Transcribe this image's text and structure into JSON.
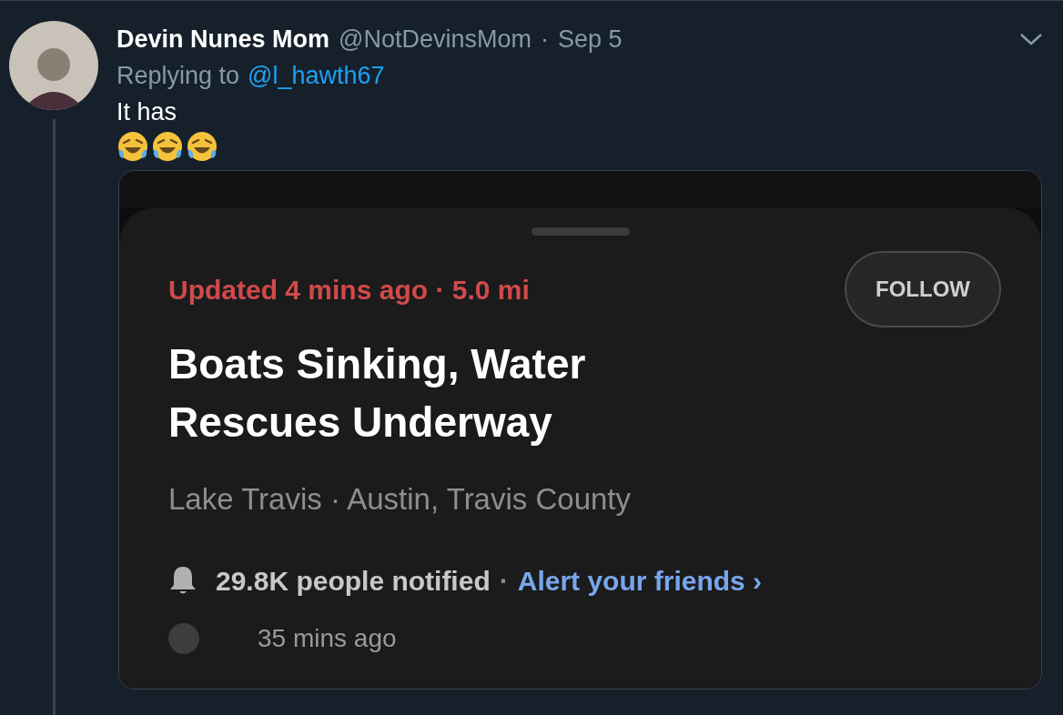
{
  "tweet": {
    "author_name": "Devin Nunes Mom",
    "handle": "@NotDevinsMom",
    "separator": "·",
    "date": "Sep 5",
    "replying_prefix": "Replying to",
    "replying_to": "@l_hawth67",
    "text": "It has"
  },
  "embedded_screenshot": {
    "meta": "Updated 4 mins ago · 5.0 mi",
    "follow_button": "FOLLOW",
    "title": "Boats Sinking, Water Rescues Underway",
    "location": "Lake Travis · Austin, Travis County",
    "notified": "29.8K people notified",
    "notified_separator": "·",
    "alert_link": "Alert your friends ›",
    "timeline_time": "35 mins ago"
  }
}
